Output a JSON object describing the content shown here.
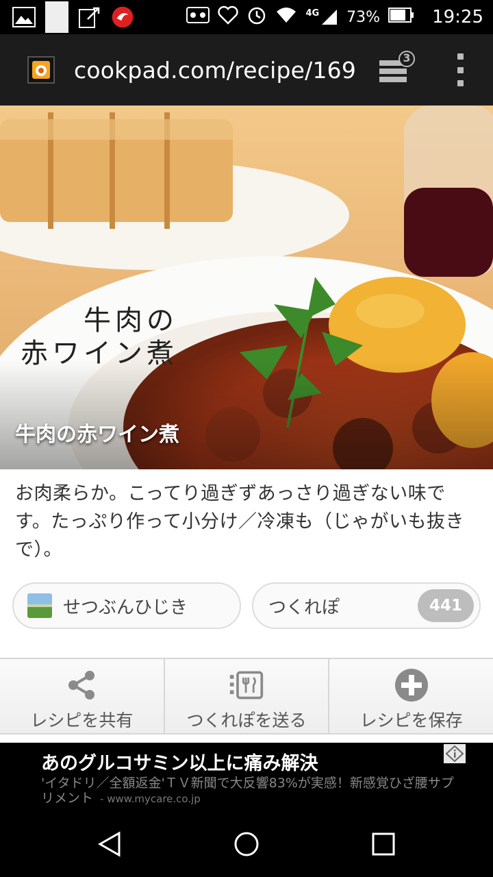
{
  "status_bar": {
    "battery": "73%",
    "network": "4G",
    "time": "19:25"
  },
  "browser": {
    "url": "cookpad.com/recipe/169",
    "tab_count": "3"
  },
  "recipe": {
    "image_title": "牛肉の赤ワイン煮",
    "image_calligraphy_line1": "牛肉の",
    "image_calligraphy_line2": "赤ワイン煮",
    "description": "お肉柔らか。こってり過ぎずあっさり過ぎない味です。たっぷり作って小分け／冷凍も（じゃがいも抜きで）。",
    "author": "せつぶんひじき",
    "tsukurepo_label": "つくれぽ",
    "tsukurepo_count": "441"
  },
  "actions": {
    "share": "レシピを共有",
    "send_tsukurepo": "つくれぽを送る",
    "save": "レシピを保存"
  },
  "ad": {
    "title": "あのグルコサミン以上に痛み解決",
    "body": "'イタドリ／全額返金'ＴＶ新聞で大反響83%が実感！新感覚ひざ腰サプリメント",
    "domain": "- www.mycare.co.jp"
  },
  "icons": {
    "share": "share-icon",
    "tsukurepo": "tsukurepo-icon",
    "save": "plus-circle-icon",
    "back": "back-triangle-icon",
    "home": "home-circle-icon",
    "recents": "recents-square-icon"
  },
  "colors": {
    "status_bar_bg": "#000000",
    "url_bar_bg": "#1c1c1c",
    "badge_bg": "#bdbdbd"
  }
}
